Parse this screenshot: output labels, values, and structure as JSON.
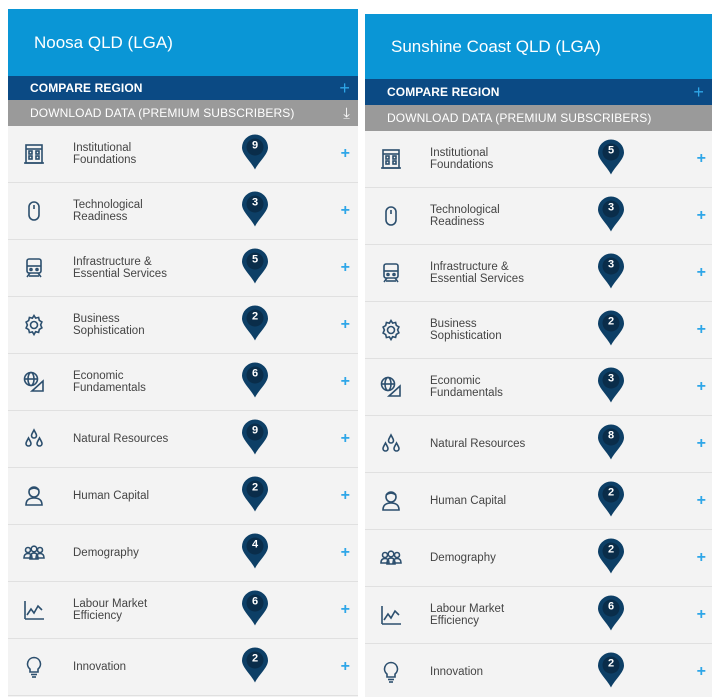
{
  "panels": [
    {
      "region": "Noosa QLD (LGA)",
      "compare_label": "COMPARE REGION",
      "download_label": "DOWNLOAD DATA (PREMIUM SUBSCRIBERS)",
      "items": [
        {
          "label": "Institutional\nFoundations",
          "score": "9",
          "icon": "building-icon"
        },
        {
          "label": "Technological\nReadiness",
          "score": "3",
          "icon": "mouse-icon"
        },
        {
          "label": "Infrastructure &\nEssential Services",
          "score": "5",
          "icon": "train-icon"
        },
        {
          "label": "Business\nSophistication",
          "score": "2",
          "icon": "gear-icon"
        },
        {
          "label": "Economic\nFundamentals",
          "score": "6",
          "icon": "globe-icon"
        },
        {
          "label": "Natural Resources",
          "score": "9",
          "icon": "water-drops-icon"
        },
        {
          "label": "Human Capital",
          "score": "2",
          "icon": "person-icon"
        },
        {
          "label": "Demography",
          "score": "4",
          "icon": "group-icon"
        },
        {
          "label": "Labour Market\nEfficiency",
          "score": "6",
          "icon": "line-chart-icon"
        },
        {
          "label": "Innovation",
          "score": "2",
          "icon": "lightbulb-icon"
        }
      ]
    },
    {
      "region": "Sunshine Coast QLD (LGA)",
      "compare_label": "COMPARE REGION",
      "download_label": "DOWNLOAD DATA (PREMIUM SUBSCRIBERS)",
      "items": [
        {
          "label": "Institutional\nFoundations",
          "score": "5",
          "icon": "building-icon"
        },
        {
          "label": "Technological\nReadiness",
          "score": "3",
          "icon": "mouse-icon"
        },
        {
          "label": "Infrastructure &\nEssential Services",
          "score": "3",
          "icon": "train-icon"
        },
        {
          "label": "Business\nSophistication",
          "score": "2",
          "icon": "gear-icon"
        },
        {
          "label": "Economic\nFundamentals",
          "score": "3",
          "icon": "globe-icon"
        },
        {
          "label": "Natural Resources",
          "score": "8",
          "icon": "water-drops-icon"
        },
        {
          "label": "Human Capital",
          "score": "2",
          "icon": "person-icon"
        },
        {
          "label": "Demography",
          "score": "2",
          "icon": "group-icon"
        },
        {
          "label": "Labour Market\nEfficiency",
          "score": "6",
          "icon": "line-chart-icon"
        },
        {
          "label": "Innovation",
          "score": "2",
          "icon": "lightbulb-icon"
        }
      ]
    }
  ],
  "colors": {
    "header": "#0a96d6",
    "compare_bar": "#0b4a84",
    "download_bar": "#9a9a9a",
    "pin": "#0d3f66",
    "plus": "#2ea6e8"
  }
}
